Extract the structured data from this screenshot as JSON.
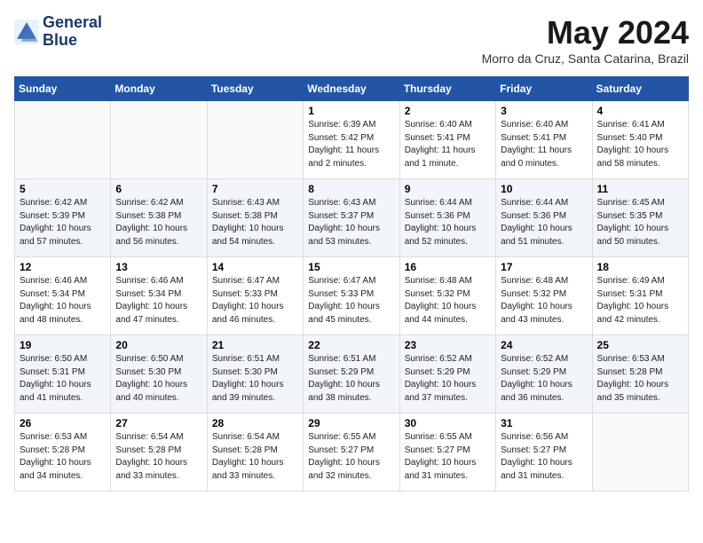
{
  "logo": {
    "line1": "General",
    "line2": "Blue"
  },
  "title": "May 2024",
  "location": "Morro da Cruz, Santa Catarina, Brazil",
  "days_header": [
    "Sunday",
    "Monday",
    "Tuesday",
    "Wednesday",
    "Thursday",
    "Friday",
    "Saturday"
  ],
  "weeks": [
    [
      {
        "num": "",
        "info": ""
      },
      {
        "num": "",
        "info": ""
      },
      {
        "num": "",
        "info": ""
      },
      {
        "num": "1",
        "info": "Sunrise: 6:39 AM\nSunset: 5:42 PM\nDaylight: 11 hours\nand 2 minutes."
      },
      {
        "num": "2",
        "info": "Sunrise: 6:40 AM\nSunset: 5:41 PM\nDaylight: 11 hours\nand 1 minute."
      },
      {
        "num": "3",
        "info": "Sunrise: 6:40 AM\nSunset: 5:41 PM\nDaylight: 11 hours\nand 0 minutes."
      },
      {
        "num": "4",
        "info": "Sunrise: 6:41 AM\nSunset: 5:40 PM\nDaylight: 10 hours\nand 58 minutes."
      }
    ],
    [
      {
        "num": "5",
        "info": "Sunrise: 6:42 AM\nSunset: 5:39 PM\nDaylight: 10 hours\nand 57 minutes."
      },
      {
        "num": "6",
        "info": "Sunrise: 6:42 AM\nSunset: 5:38 PM\nDaylight: 10 hours\nand 56 minutes."
      },
      {
        "num": "7",
        "info": "Sunrise: 6:43 AM\nSunset: 5:38 PM\nDaylight: 10 hours\nand 54 minutes."
      },
      {
        "num": "8",
        "info": "Sunrise: 6:43 AM\nSunset: 5:37 PM\nDaylight: 10 hours\nand 53 minutes."
      },
      {
        "num": "9",
        "info": "Sunrise: 6:44 AM\nSunset: 5:36 PM\nDaylight: 10 hours\nand 52 minutes."
      },
      {
        "num": "10",
        "info": "Sunrise: 6:44 AM\nSunset: 5:36 PM\nDaylight: 10 hours\nand 51 minutes."
      },
      {
        "num": "11",
        "info": "Sunrise: 6:45 AM\nSunset: 5:35 PM\nDaylight: 10 hours\nand 50 minutes."
      }
    ],
    [
      {
        "num": "12",
        "info": "Sunrise: 6:46 AM\nSunset: 5:34 PM\nDaylight: 10 hours\nand 48 minutes."
      },
      {
        "num": "13",
        "info": "Sunrise: 6:46 AM\nSunset: 5:34 PM\nDaylight: 10 hours\nand 47 minutes."
      },
      {
        "num": "14",
        "info": "Sunrise: 6:47 AM\nSunset: 5:33 PM\nDaylight: 10 hours\nand 46 minutes."
      },
      {
        "num": "15",
        "info": "Sunrise: 6:47 AM\nSunset: 5:33 PM\nDaylight: 10 hours\nand 45 minutes."
      },
      {
        "num": "16",
        "info": "Sunrise: 6:48 AM\nSunset: 5:32 PM\nDaylight: 10 hours\nand 44 minutes."
      },
      {
        "num": "17",
        "info": "Sunrise: 6:48 AM\nSunset: 5:32 PM\nDaylight: 10 hours\nand 43 minutes."
      },
      {
        "num": "18",
        "info": "Sunrise: 6:49 AM\nSunset: 5:31 PM\nDaylight: 10 hours\nand 42 minutes."
      }
    ],
    [
      {
        "num": "19",
        "info": "Sunrise: 6:50 AM\nSunset: 5:31 PM\nDaylight: 10 hours\nand 41 minutes."
      },
      {
        "num": "20",
        "info": "Sunrise: 6:50 AM\nSunset: 5:30 PM\nDaylight: 10 hours\nand 40 minutes."
      },
      {
        "num": "21",
        "info": "Sunrise: 6:51 AM\nSunset: 5:30 PM\nDaylight: 10 hours\nand 39 minutes."
      },
      {
        "num": "22",
        "info": "Sunrise: 6:51 AM\nSunset: 5:29 PM\nDaylight: 10 hours\nand 38 minutes."
      },
      {
        "num": "23",
        "info": "Sunrise: 6:52 AM\nSunset: 5:29 PM\nDaylight: 10 hours\nand 37 minutes."
      },
      {
        "num": "24",
        "info": "Sunrise: 6:52 AM\nSunset: 5:29 PM\nDaylight: 10 hours\nand 36 minutes."
      },
      {
        "num": "25",
        "info": "Sunrise: 6:53 AM\nSunset: 5:28 PM\nDaylight: 10 hours\nand 35 minutes."
      }
    ],
    [
      {
        "num": "26",
        "info": "Sunrise: 6:53 AM\nSunset: 5:28 PM\nDaylight: 10 hours\nand 34 minutes."
      },
      {
        "num": "27",
        "info": "Sunrise: 6:54 AM\nSunset: 5:28 PM\nDaylight: 10 hours\nand 33 minutes."
      },
      {
        "num": "28",
        "info": "Sunrise: 6:54 AM\nSunset: 5:28 PM\nDaylight: 10 hours\nand 33 minutes."
      },
      {
        "num": "29",
        "info": "Sunrise: 6:55 AM\nSunset: 5:27 PM\nDaylight: 10 hours\nand 32 minutes."
      },
      {
        "num": "30",
        "info": "Sunrise: 6:55 AM\nSunset: 5:27 PM\nDaylight: 10 hours\nand 31 minutes."
      },
      {
        "num": "31",
        "info": "Sunrise: 6:56 AM\nSunset: 5:27 PM\nDaylight: 10 hours\nand 31 minutes."
      },
      {
        "num": "",
        "info": ""
      }
    ]
  ]
}
